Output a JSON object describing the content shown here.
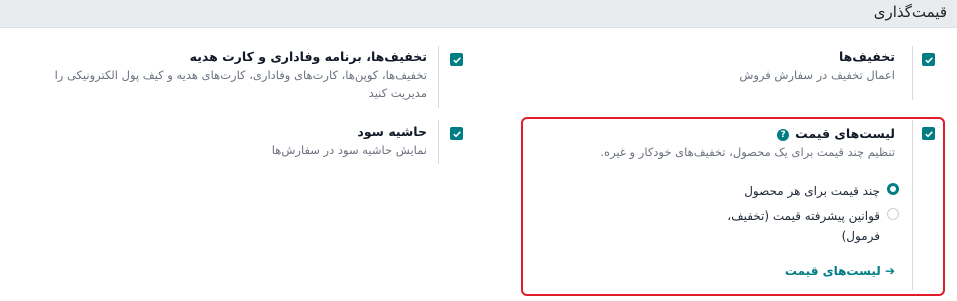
{
  "section": {
    "title": "قیمت‌گذاری"
  },
  "settings": {
    "discounts": {
      "title": "تخفیف‌ها",
      "description": "اعمال تخفیف در سفارش فروش",
      "checked": true
    },
    "loyalty": {
      "title": "تخفیف‌ها، برنامه وفاداری و کارت هدیه",
      "description": "تخفیف‌ها، کوپن‌ها، کارت‌های وفاداری، کارت‌های هدیه و کیف پول الکترونیکی را مدیریت کنید",
      "checked": true
    },
    "pricelists": {
      "title": "لیست‌های قیمت",
      "help_icon": "question-circle-icon",
      "description": "تنظیم چند قیمت برای یک محصول، تخفیف‌های خودکار و غیره.",
      "checked": true,
      "options": [
        {
          "label": "چند قیمت برای هر محصول",
          "selected": true
        },
        {
          "label": "قوانین پیشرفته قیمت (تخفیف، فرمول)",
          "selected": false
        }
      ],
      "link_label": "لیست‌های قیمت",
      "link_icon": "arrow-right-icon"
    },
    "margins": {
      "title": "حاشیه سود",
      "description": "نمایش حاشیه سود در سفارش‌ها",
      "checked": true
    }
  },
  "colors": {
    "accent": "#017e84",
    "highlight": "#e11d2a"
  }
}
